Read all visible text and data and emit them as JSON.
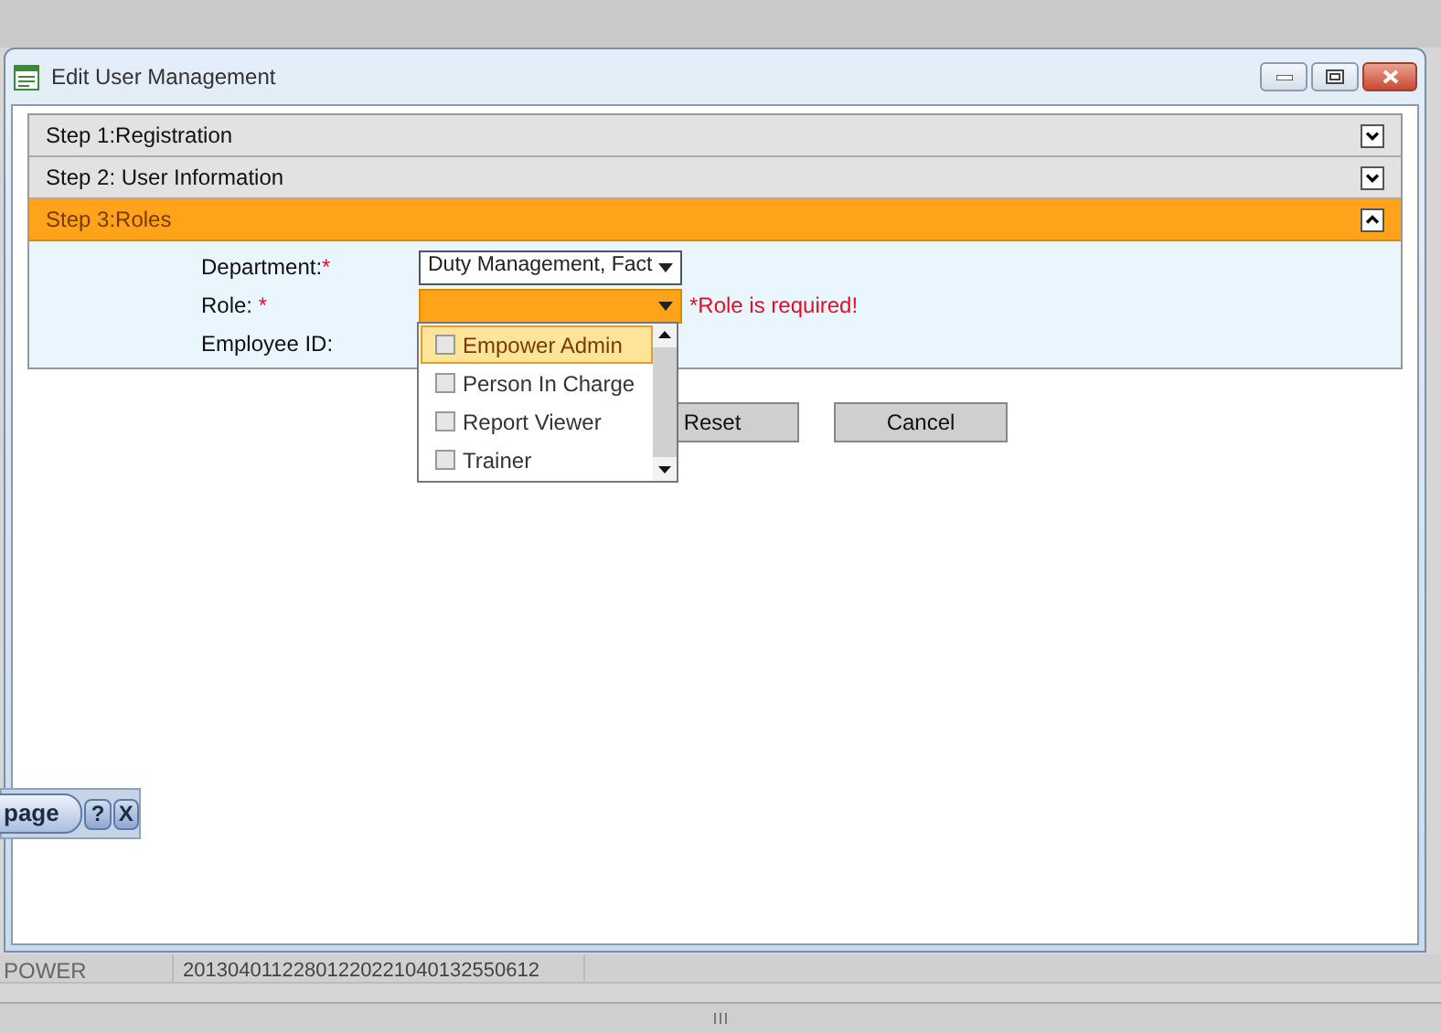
{
  "window": {
    "title": "Edit User Management"
  },
  "steps": [
    {
      "title": "Step 1:Registration",
      "expanded": false
    },
    {
      "title": "Step 2: User Information",
      "expanded": false
    },
    {
      "title": "Step 3:Roles",
      "expanded": true
    }
  ],
  "fields": [
    {
      "kind": "select",
      "label": "Department:",
      "required_mark": "*",
      "value": "Duty Management, Fact",
      "focused": false
    },
    {
      "kind": "select",
      "label": "Role: ",
      "required_mark": "*",
      "focused": true,
      "error": "*Role is required!"
    },
    {
      "kind": "text",
      "label": "Employee ID:"
    }
  ],
  "role_options": [
    {
      "label": "Empower Admin",
      "checked": false,
      "selected": true
    },
    {
      "label": "Person In Charge",
      "checked": false,
      "selected": false
    },
    {
      "label": "Report Viewer",
      "checked": false,
      "selected": false
    },
    {
      "label": "Trainer",
      "checked": false,
      "selected": false
    }
  ],
  "buttons": [
    "Reset",
    "Cancel"
  ],
  "background": {
    "page_button": "page",
    "help": "?",
    "close": "X",
    "row": [
      "POWER",
      "20130401122801220221040132550612"
    ]
  }
}
